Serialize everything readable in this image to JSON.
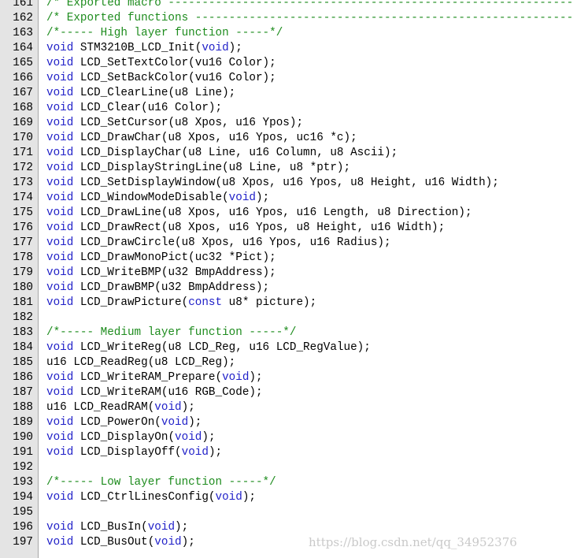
{
  "editor": {
    "colors": {
      "keyword": "#1f1fc8",
      "comment": "#1e8c1e",
      "text": "#000000",
      "gutter_bg": "#e4e4e4"
    },
    "lines": [
      {
        "num": "161",
        "segs": [
          {
            "t": "/* Exported macro ------------------------------------------------------------",
            "c": "cm"
          }
        ]
      },
      {
        "num": "162",
        "segs": [
          {
            "t": "/* Exported functions --------------------------------------------------------",
            "c": "cm"
          }
        ]
      },
      {
        "num": "163",
        "segs": [
          {
            "t": "/*----- High layer function -----*/",
            "c": "cm"
          }
        ]
      },
      {
        "num": "164",
        "segs": [
          {
            "t": "void",
            "c": "kw"
          },
          {
            "t": " STM3210B_LCD_Init(",
            "c": ""
          },
          {
            "t": "void",
            "c": "kw"
          },
          {
            "t": ");",
            "c": ""
          }
        ]
      },
      {
        "num": "165",
        "segs": [
          {
            "t": "void",
            "c": "kw"
          },
          {
            "t": " LCD_SetTextColor(vu16 Color);",
            "c": ""
          }
        ]
      },
      {
        "num": "166",
        "segs": [
          {
            "t": "void",
            "c": "kw"
          },
          {
            "t": " LCD_SetBackColor(vu16 Color);",
            "c": ""
          }
        ]
      },
      {
        "num": "167",
        "segs": [
          {
            "t": "void",
            "c": "kw"
          },
          {
            "t": " LCD_ClearLine(u8 Line);",
            "c": ""
          }
        ]
      },
      {
        "num": "168",
        "segs": [
          {
            "t": "void",
            "c": "kw"
          },
          {
            "t": " LCD_Clear(u16 Color);",
            "c": ""
          }
        ]
      },
      {
        "num": "169",
        "segs": [
          {
            "t": "void",
            "c": "kw"
          },
          {
            "t": " LCD_SetCursor(u8 Xpos, u16 Ypos);",
            "c": ""
          }
        ]
      },
      {
        "num": "170",
        "segs": [
          {
            "t": "void",
            "c": "kw"
          },
          {
            "t": " LCD_DrawChar(u8 Xpos, u16 Ypos, uc16 *c);",
            "c": ""
          }
        ]
      },
      {
        "num": "171",
        "segs": [
          {
            "t": "void",
            "c": "kw"
          },
          {
            "t": " LCD_DisplayChar(u8 Line, u16 Column, u8 Ascii);",
            "c": ""
          }
        ]
      },
      {
        "num": "172",
        "segs": [
          {
            "t": "void",
            "c": "kw"
          },
          {
            "t": " LCD_DisplayStringLine(u8 Line, u8 *ptr);",
            "c": ""
          }
        ]
      },
      {
        "num": "173",
        "segs": [
          {
            "t": "void",
            "c": "kw"
          },
          {
            "t": " LCD_SetDisplayWindow(u8 Xpos, u16 Ypos, u8 Height, u16 Width);",
            "c": ""
          }
        ]
      },
      {
        "num": "174",
        "segs": [
          {
            "t": "void",
            "c": "kw"
          },
          {
            "t": " LCD_WindowModeDisable(",
            "c": ""
          },
          {
            "t": "void",
            "c": "kw"
          },
          {
            "t": ");",
            "c": ""
          }
        ]
      },
      {
        "num": "175",
        "segs": [
          {
            "t": "void",
            "c": "kw"
          },
          {
            "t": " LCD_DrawLine(u8 Xpos, u16 Ypos, u16 Length, u8 Direction);",
            "c": ""
          }
        ]
      },
      {
        "num": "176",
        "segs": [
          {
            "t": "void",
            "c": "kw"
          },
          {
            "t": " LCD_DrawRect(u8 Xpos, u16 Ypos, u8 Height, u16 Width);",
            "c": ""
          }
        ]
      },
      {
        "num": "177",
        "segs": [
          {
            "t": "void",
            "c": "kw"
          },
          {
            "t": " LCD_DrawCircle(u8 Xpos, u16 Ypos, u16 Radius);",
            "c": ""
          }
        ]
      },
      {
        "num": "178",
        "segs": [
          {
            "t": "void",
            "c": "kw"
          },
          {
            "t": " LCD_DrawMonoPict(uc32 *Pict);",
            "c": ""
          }
        ]
      },
      {
        "num": "179",
        "segs": [
          {
            "t": "void",
            "c": "kw"
          },
          {
            "t": " LCD_WriteBMP(u32 BmpAddress);",
            "c": ""
          }
        ]
      },
      {
        "num": "180",
        "segs": [
          {
            "t": "void",
            "c": "kw"
          },
          {
            "t": " LCD_DrawBMP(u32 BmpAddress);",
            "c": ""
          }
        ]
      },
      {
        "num": "181",
        "segs": [
          {
            "t": "void",
            "c": "kw"
          },
          {
            "t": " LCD_DrawPicture(",
            "c": ""
          },
          {
            "t": "const",
            "c": "kw"
          },
          {
            "t": " u8* picture);",
            "c": ""
          }
        ]
      },
      {
        "num": "182",
        "segs": []
      },
      {
        "num": "183",
        "segs": [
          {
            "t": "/*----- Medium layer function -----*/",
            "c": "cm"
          }
        ]
      },
      {
        "num": "184",
        "segs": [
          {
            "t": "void",
            "c": "kw"
          },
          {
            "t": " LCD_WriteReg(u8 LCD_Reg, u16 LCD_RegValue);",
            "c": ""
          }
        ]
      },
      {
        "num": "185",
        "segs": [
          {
            "t": "u16 LCD_ReadReg(u8 LCD_Reg);",
            "c": ""
          }
        ]
      },
      {
        "num": "186",
        "segs": [
          {
            "t": "void",
            "c": "kw"
          },
          {
            "t": " LCD_WriteRAM_Prepare(",
            "c": ""
          },
          {
            "t": "void",
            "c": "kw"
          },
          {
            "t": ");",
            "c": ""
          }
        ]
      },
      {
        "num": "187",
        "segs": [
          {
            "t": "void",
            "c": "kw"
          },
          {
            "t": " LCD_WriteRAM(u16 RGB_Code);",
            "c": ""
          }
        ]
      },
      {
        "num": "188",
        "segs": [
          {
            "t": "u16 LCD_ReadRAM(",
            "c": ""
          },
          {
            "t": "void",
            "c": "kw"
          },
          {
            "t": ");",
            "c": ""
          }
        ]
      },
      {
        "num": "189",
        "segs": [
          {
            "t": "void",
            "c": "kw"
          },
          {
            "t": " LCD_PowerOn(",
            "c": ""
          },
          {
            "t": "void",
            "c": "kw"
          },
          {
            "t": ");",
            "c": ""
          }
        ]
      },
      {
        "num": "190",
        "segs": [
          {
            "t": "void",
            "c": "kw"
          },
          {
            "t": " LCD_DisplayOn(",
            "c": ""
          },
          {
            "t": "void",
            "c": "kw"
          },
          {
            "t": ");",
            "c": ""
          }
        ]
      },
      {
        "num": "191",
        "segs": [
          {
            "t": "void",
            "c": "kw"
          },
          {
            "t": " LCD_DisplayOff(",
            "c": ""
          },
          {
            "t": "void",
            "c": "kw"
          },
          {
            "t": ");",
            "c": ""
          }
        ]
      },
      {
        "num": "192",
        "segs": []
      },
      {
        "num": "193",
        "segs": [
          {
            "t": "/*----- Low layer function -----*/",
            "c": "cm"
          }
        ]
      },
      {
        "num": "194",
        "segs": [
          {
            "t": "void",
            "c": "kw"
          },
          {
            "t": " LCD_CtrlLinesConfig(",
            "c": ""
          },
          {
            "t": "void",
            "c": "kw"
          },
          {
            "t": ");",
            "c": ""
          }
        ]
      },
      {
        "num": "195",
        "segs": []
      },
      {
        "num": "196",
        "segs": [
          {
            "t": "void",
            "c": "kw"
          },
          {
            "t": " LCD_BusIn(",
            "c": ""
          },
          {
            "t": "void",
            "c": "kw"
          },
          {
            "t": ");",
            "c": ""
          }
        ]
      },
      {
        "num": "197",
        "segs": [
          {
            "t": "void",
            "c": "kw"
          },
          {
            "t": " LCD_BusOut(",
            "c": ""
          },
          {
            "t": "void",
            "c": "kw"
          },
          {
            "t": ");",
            "c": ""
          }
        ]
      }
    ]
  },
  "watermark": "https://blog.csdn.net/qq_34952376"
}
